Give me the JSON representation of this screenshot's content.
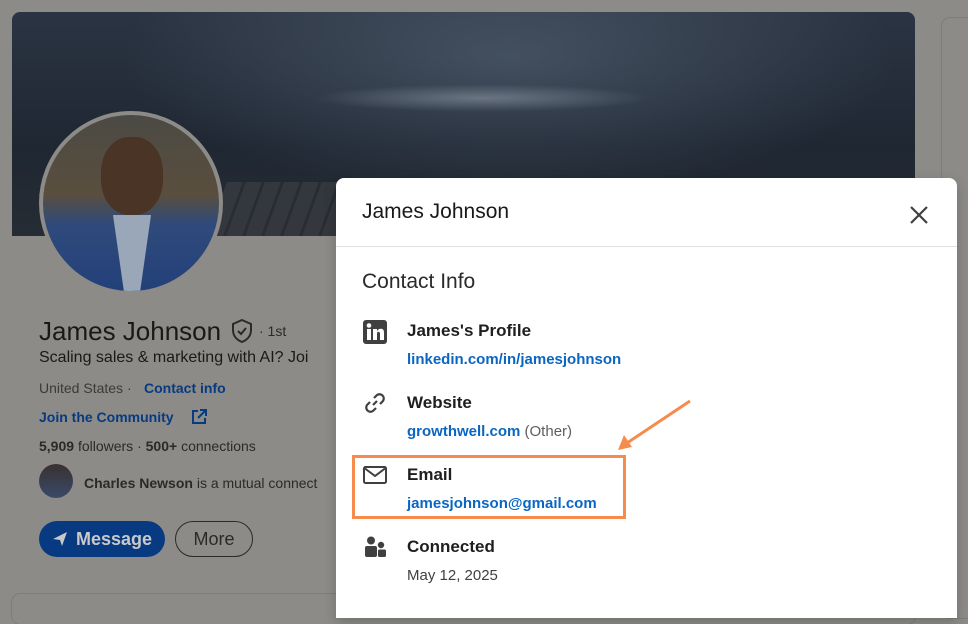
{
  "profile": {
    "name": "James Johnson",
    "degree": "· 1st",
    "headline": "Scaling sales & marketing with AI? Joi",
    "location": "United States ·",
    "contact_info_link": "Contact info",
    "join_link": "Join the Community",
    "followers": "5,909",
    "followers_label": "followers",
    "separator": "·",
    "connections": "500+",
    "connections_label": "connections",
    "mutual_name": "Charles Newson",
    "mutual_text": "is a mutual connect",
    "message_button": "Message",
    "more_button": "More"
  },
  "modal": {
    "title": "James Johnson",
    "section_title": "Contact Info",
    "items": [
      {
        "icon": "linkedin-icon",
        "label": "James's Profile",
        "value": "linkedin.com/in/jamesjohnson",
        "note": ""
      },
      {
        "icon": "link-icon",
        "label": "Website",
        "value": "growthwell.com",
        "note": "(Other)"
      },
      {
        "icon": "envelope-icon",
        "label": "Email",
        "value": "jamesjohnson@gmail.com",
        "note": ""
      },
      {
        "icon": "people-icon",
        "label": "Connected",
        "value": "May 12, 2025",
        "note": ""
      }
    ]
  },
  "annotation": {
    "highlight_color": "#f58b4c",
    "highlight_target": "Email"
  },
  "colors": {
    "link_blue": "#0a66c2",
    "primary_button": "#073a80",
    "overlay_bg": "#8c8b88"
  }
}
